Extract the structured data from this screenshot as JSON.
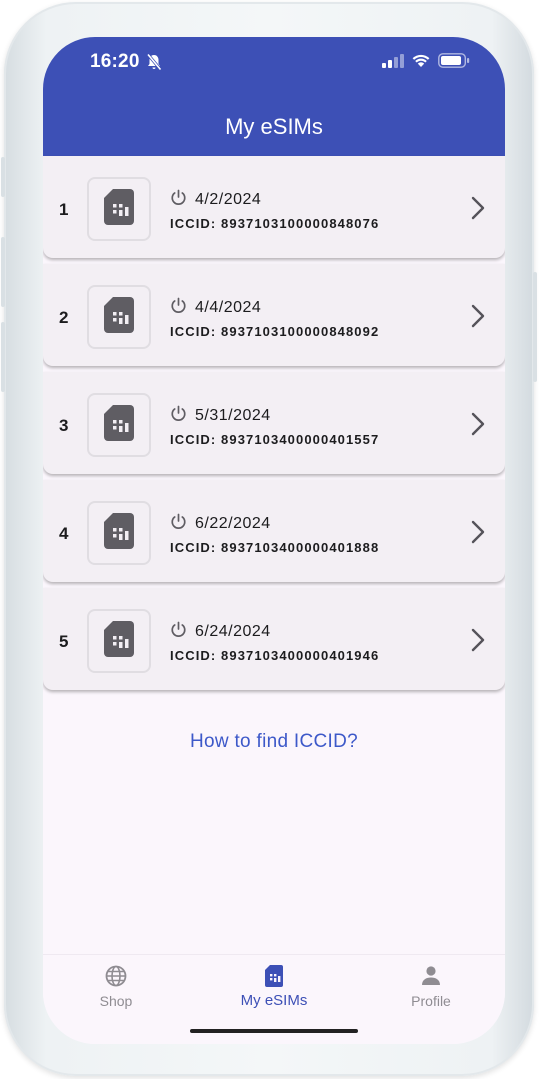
{
  "status_bar": {
    "time": "16:20"
  },
  "app_bar": {
    "title": "My eSIMs"
  },
  "esims": [
    {
      "index": "1",
      "date": "4/2/2024",
      "iccid": "ICCID: 8937103100000848076"
    },
    {
      "index": "2",
      "date": "4/4/2024",
      "iccid": "ICCID: 8937103100000848092"
    },
    {
      "index": "3",
      "date": "5/31/2024",
      "iccid": "ICCID: 8937103400000401557"
    },
    {
      "index": "4",
      "date": "6/22/2024",
      "iccid": "ICCID: 8937103400000401888"
    },
    {
      "index": "5",
      "date": "6/24/2024",
      "iccid": "ICCID: 8937103400000401946"
    }
  ],
  "help_link": "How to find ICCID?",
  "bottom_nav": {
    "items": [
      {
        "label": "Shop",
        "icon": "globe-icon",
        "active": false
      },
      {
        "label": "My eSIMs",
        "icon": "sim-card-icon",
        "active": true
      },
      {
        "label": "Profile",
        "icon": "person-icon",
        "active": false
      }
    ]
  },
  "colors": {
    "primary": "#3d50b6",
    "link": "#3d59c9",
    "card_bg": "#f3eff4",
    "screen_bg": "#fbf6fc",
    "inactive_nav": "#8f8c92"
  }
}
